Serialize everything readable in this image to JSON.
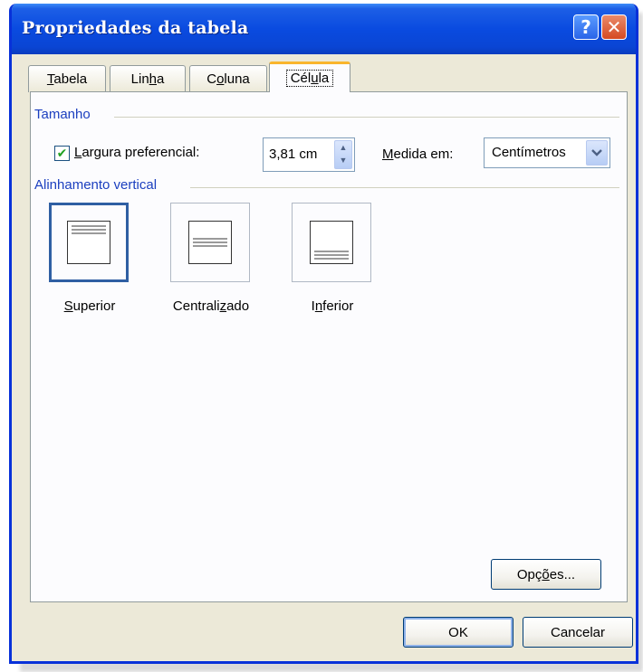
{
  "dialog": {
    "title": "Propriedades da tabela",
    "help_glyph": "?",
    "close_glyph": "✕"
  },
  "tabs": [
    {
      "label": "Tabela",
      "accel": "T",
      "rest": "abela"
    },
    {
      "label": "Linha",
      "pre": "Lin",
      "accel": "h",
      "rest": "a"
    },
    {
      "label": "Coluna",
      "pre": "C",
      "accel": "o",
      "rest": "luna"
    },
    {
      "label": "Célula",
      "pre": "Cél",
      "accel": "u",
      "rest": "la",
      "active": true
    }
  ],
  "size_section": {
    "title": "Tamanho",
    "checkbox_checked": true,
    "checkbox_label_accel": "L",
    "checkbox_label_rest": "argura preferencial:",
    "width_value": "3,81 cm",
    "measure_label_accel": "M",
    "measure_label_rest": "edida em:",
    "measure_value": "Centímetros"
  },
  "align_section": {
    "title": "Alinhamento vertical",
    "options": [
      {
        "pre": "",
        "accel": "S",
        "rest": "uperior",
        "selected": true
      },
      {
        "pre": "Centrali",
        "accel": "z",
        "rest": "ado",
        "selected": false
      },
      {
        "pre": "I",
        "accel": "n",
        "rest": "ferior",
        "selected": false
      }
    ]
  },
  "buttons": {
    "options_pre": "Opç",
    "options_accel": "õ",
    "options_rest": "es...",
    "ok": "OK",
    "cancel": "Cancelar"
  },
  "icons": {
    "check": "✔",
    "spin_up": "▲",
    "spin_down": "▼",
    "combo_arrow": "⌄"
  },
  "colors": {
    "title_bar": "#0a4be0",
    "section_heading": "#1b3fbf",
    "active_tab_accent": "#f9b52d",
    "dialog_face": "#ece9d8"
  }
}
